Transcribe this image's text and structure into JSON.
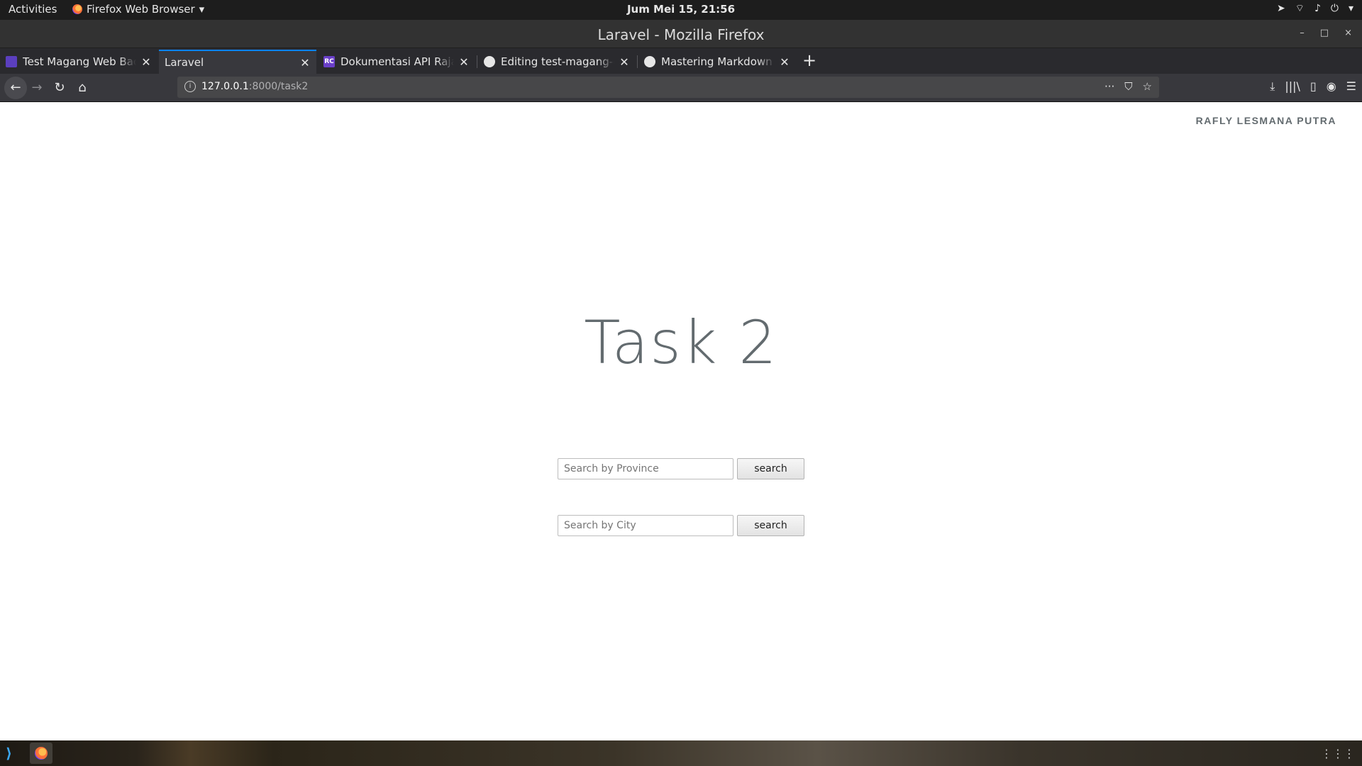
{
  "topbar": {
    "activities": "Activities",
    "app_menu": "Firefox Web Browser",
    "app_menu_caret": "▾",
    "clock": "Jum Mei 15, 21:56",
    "tray_icons": [
      "telegram-icon",
      "wifi-icon",
      "volume-icon",
      "power-icon",
      "chevron-down-icon"
    ]
  },
  "window": {
    "title": "Laravel - Mozilla Firefox",
    "minimize": "–",
    "maximize": "□",
    "close": "×"
  },
  "tabs": [
    {
      "label": "Test Magang Web Backe",
      "icon": "doc-icon",
      "active": false
    },
    {
      "label": "Laravel",
      "icon": "",
      "active": true
    },
    {
      "label": "Dokumentasi API RajaO",
      "icon": "rc-icon",
      "active": false
    },
    {
      "label": "Editing test-magang-do",
      "icon": "github-icon",
      "active": false
    },
    {
      "label": "Mastering Markdown · G",
      "icon": "github-icon",
      "active": false
    }
  ],
  "tab_close": "✕",
  "new_tab": "+",
  "nav": {
    "back": "←",
    "forward": "→",
    "reload": "↻",
    "home": "⌂",
    "url_host": "127.0.0.1",
    "url_rest": ":8000/task2",
    "info": "i",
    "more": "···",
    "pocket": "⛉",
    "bookmark": "☆",
    "download": "⤓",
    "library": "|||\\",
    "sidebar": "▯",
    "account": "◉",
    "menu": "☰"
  },
  "page": {
    "user": "RAFLY LESMANA PUTRA",
    "heading": "Task 2",
    "province_form": {
      "placeholder": "Search by Province",
      "value": "",
      "button": "search"
    },
    "city_form": {
      "placeholder": "Search by City",
      "value": "",
      "button": "search"
    }
  },
  "dock": {
    "vscode": "⟩",
    "apps_grid": "⋮⋮⋮"
  },
  "colors": {
    "accent": "#0a84ff",
    "heading": "#636b6f"
  }
}
